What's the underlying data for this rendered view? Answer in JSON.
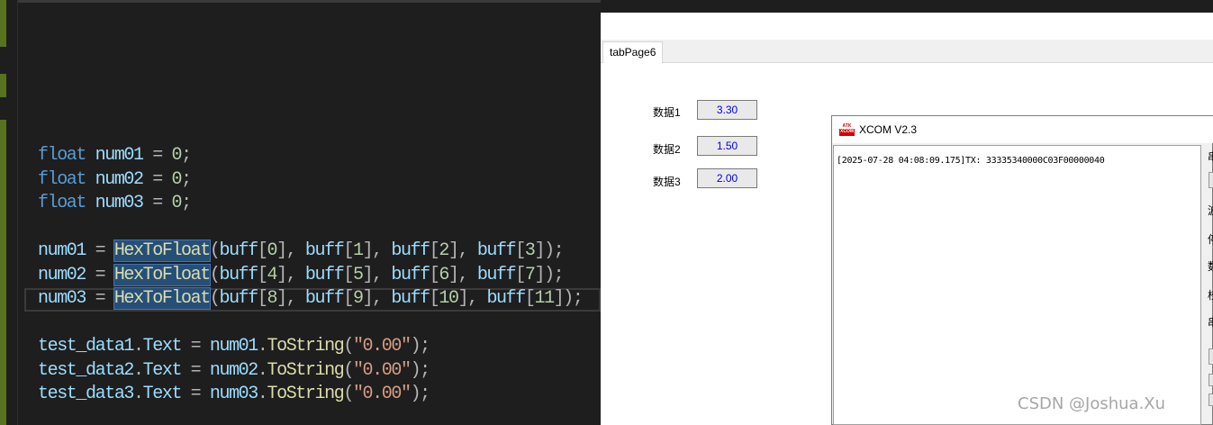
{
  "editor": {
    "lines": [
      [
        {
          "t": "float",
          "c": "kw"
        },
        {
          "t": " ",
          "c": "op"
        },
        {
          "t": "num01",
          "c": "var"
        },
        {
          "t": " = ",
          "c": "op"
        },
        {
          "t": "0",
          "c": "num"
        },
        {
          "t": ";",
          "c": "op"
        }
      ],
      [
        {
          "t": "float",
          "c": "kw"
        },
        {
          "t": " ",
          "c": "op"
        },
        {
          "t": "num02",
          "c": "var"
        },
        {
          "t": " = ",
          "c": "op"
        },
        {
          "t": "0",
          "c": "num"
        },
        {
          "t": ";",
          "c": "op"
        }
      ],
      [
        {
          "t": "float",
          "c": "kw"
        },
        {
          "t": " ",
          "c": "op"
        },
        {
          "t": "num03",
          "c": "var"
        },
        {
          "t": " = ",
          "c": "op"
        },
        {
          "t": "0",
          "c": "num"
        },
        {
          "t": ";",
          "c": "op"
        }
      ],
      [],
      [
        {
          "t": "num01",
          "c": "var"
        },
        {
          "t": " = ",
          "c": "op"
        },
        {
          "t": "HexToFloat",
          "c": "fn hl"
        },
        {
          "t": "(",
          "c": "op"
        },
        {
          "t": "buff",
          "c": "var"
        },
        {
          "t": "[",
          "c": "op"
        },
        {
          "t": "0",
          "c": "num"
        },
        {
          "t": "], ",
          "c": "op"
        },
        {
          "t": "buff",
          "c": "var"
        },
        {
          "t": "[",
          "c": "op"
        },
        {
          "t": "1",
          "c": "num"
        },
        {
          "t": "], ",
          "c": "op"
        },
        {
          "t": "buff",
          "c": "var"
        },
        {
          "t": "[",
          "c": "op"
        },
        {
          "t": "2",
          "c": "num"
        },
        {
          "t": "], ",
          "c": "op"
        },
        {
          "t": "buff",
          "c": "var"
        },
        {
          "t": "[",
          "c": "op"
        },
        {
          "t": "3",
          "c": "num"
        },
        {
          "t": "]);",
          "c": "op"
        }
      ],
      [
        {
          "t": "num02",
          "c": "var"
        },
        {
          "t": " = ",
          "c": "op"
        },
        {
          "t": "HexToFloat",
          "c": "fn hl"
        },
        {
          "t": "(",
          "c": "op"
        },
        {
          "t": "buff",
          "c": "var"
        },
        {
          "t": "[",
          "c": "op"
        },
        {
          "t": "4",
          "c": "num"
        },
        {
          "t": "], ",
          "c": "op"
        },
        {
          "t": "buff",
          "c": "var"
        },
        {
          "t": "[",
          "c": "op"
        },
        {
          "t": "5",
          "c": "num"
        },
        {
          "t": "], ",
          "c": "op"
        },
        {
          "t": "buff",
          "c": "var"
        },
        {
          "t": "[",
          "c": "op"
        },
        {
          "t": "6",
          "c": "num"
        },
        {
          "t": "], ",
          "c": "op"
        },
        {
          "t": "buff",
          "c": "var"
        },
        {
          "t": "[",
          "c": "op"
        },
        {
          "t": "7",
          "c": "num"
        },
        {
          "t": "]);",
          "c": "op"
        }
      ],
      [
        {
          "t": "num03",
          "c": "var"
        },
        {
          "t": " = ",
          "c": "op"
        },
        {
          "t": "HexToFloat",
          "c": "fn hl"
        },
        {
          "t": "(",
          "c": "op"
        },
        {
          "t": "buff",
          "c": "var"
        },
        {
          "t": "[",
          "c": "op"
        },
        {
          "t": "8",
          "c": "num"
        },
        {
          "t": "], ",
          "c": "op"
        },
        {
          "t": "buff",
          "c": "var"
        },
        {
          "t": "[",
          "c": "op"
        },
        {
          "t": "9",
          "c": "num"
        },
        {
          "t": "], ",
          "c": "op"
        },
        {
          "t": "buff",
          "c": "var"
        },
        {
          "t": "[",
          "c": "op"
        },
        {
          "t": "10",
          "c": "num"
        },
        {
          "t": "], ",
          "c": "op"
        },
        {
          "t": "buff",
          "c": "var"
        },
        {
          "t": "[",
          "c": "op"
        },
        {
          "t": "11",
          "c": "num"
        },
        {
          "t": "]);",
          "c": "op"
        }
      ],
      [],
      [
        {
          "t": "test_data1",
          "c": "var"
        },
        {
          "t": ".",
          "c": "op"
        },
        {
          "t": "Text",
          "c": "var"
        },
        {
          "t": " = ",
          "c": "op"
        },
        {
          "t": "num01",
          "c": "var"
        },
        {
          "t": ".",
          "c": "op"
        },
        {
          "t": "ToString",
          "c": "fn"
        },
        {
          "t": "(",
          "c": "op"
        },
        {
          "t": "\"0.00\"",
          "c": "str"
        },
        {
          "t": ");",
          "c": "op"
        }
      ],
      [
        {
          "t": "test_data2",
          "c": "var"
        },
        {
          "t": ".",
          "c": "op"
        },
        {
          "t": "Text",
          "c": "var"
        },
        {
          "t": " = ",
          "c": "op"
        },
        {
          "t": "num02",
          "c": "var"
        },
        {
          "t": ".",
          "c": "op"
        },
        {
          "t": "ToString",
          "c": "fn"
        },
        {
          "t": "(",
          "c": "op"
        },
        {
          "t": "\"0.00\"",
          "c": "str"
        },
        {
          "t": ");",
          "c": "op"
        }
      ],
      [
        {
          "t": "test_data3",
          "c": "var"
        },
        {
          "t": ".",
          "c": "op"
        },
        {
          "t": "Text",
          "c": "var"
        },
        {
          "t": " = ",
          "c": "op"
        },
        {
          "t": "num03",
          "c": "var"
        },
        {
          "t": ".",
          "c": "op"
        },
        {
          "t": "ToString",
          "c": "fn"
        },
        {
          "t": "(",
          "c": "op"
        },
        {
          "t": "\"0.00\"",
          "c": "str"
        },
        {
          "t": ");",
          "c": "op"
        }
      ]
    ],
    "current_line": 7
  },
  "form": {
    "tab_label": "tabPage6",
    "fields": [
      {
        "label": "数据1",
        "value": "3.30"
      },
      {
        "label": "数据2",
        "value": "1.50"
      },
      {
        "label": "数据3",
        "value": "2.00"
      }
    ]
  },
  "xcom": {
    "logo_text": "ATK XCOM",
    "title": "XCOM V2.3",
    "receive_text": "[2025-07-28 04:08:09.175]TX: 33335340000C03F00000040",
    "side_chars": [
      "串",
      "波",
      "停",
      "数",
      "校",
      "串"
    ]
  },
  "watermark": "CSDN @Joshua.Xu",
  "colors": {
    "keyword": "#569cd6",
    "identifier": "#9cdcfe",
    "number": "#b5cea8",
    "method": "#dcdcaa",
    "string": "#d69d85",
    "selection": "#264f78",
    "field_value": "#0000ee"
  }
}
